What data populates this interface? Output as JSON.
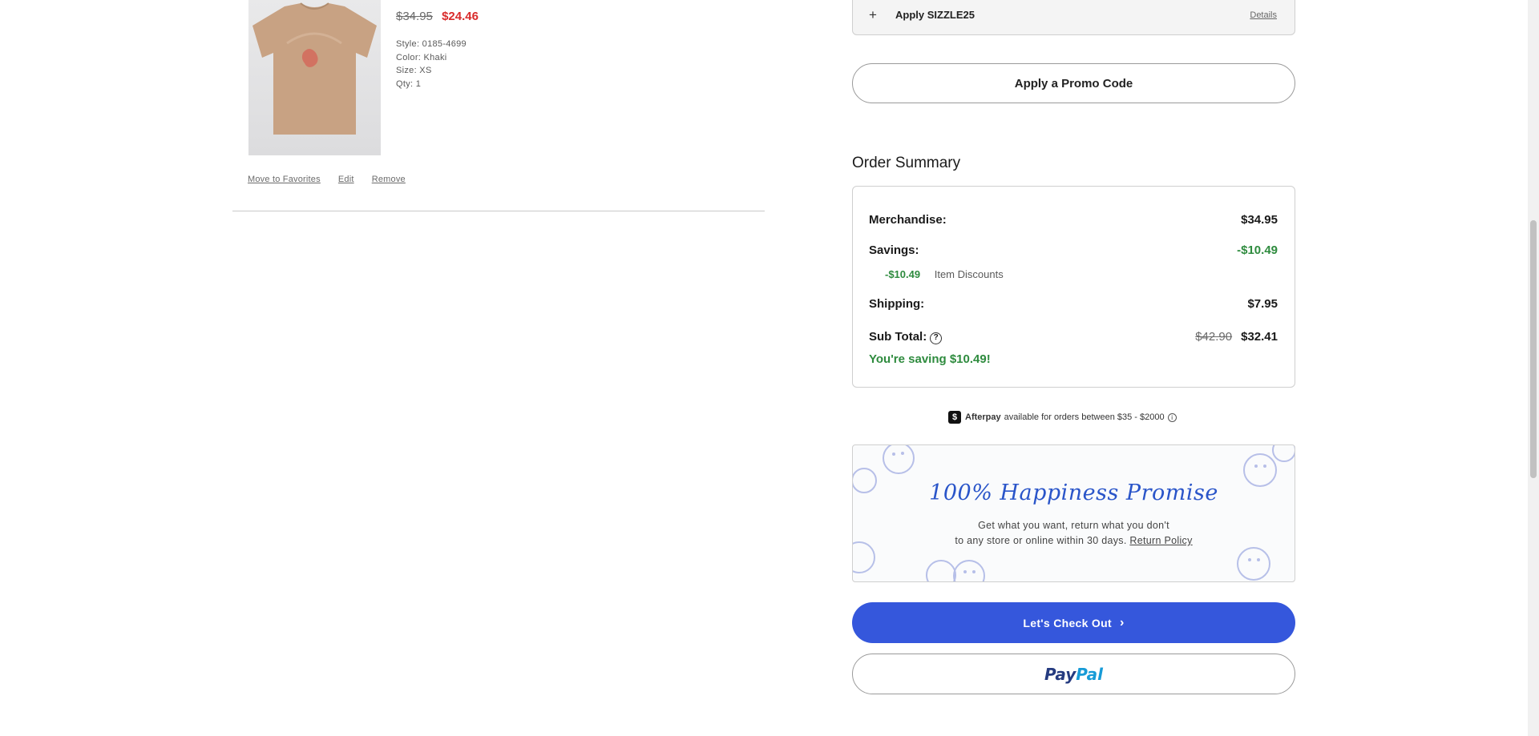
{
  "item": {
    "price_old": "$34.95",
    "price_new": "$24.46",
    "style": "Style: 0185-4699",
    "color": "Color: Khaki",
    "size": "Size: XS",
    "qty": "Qty: 1",
    "actions": [
      "Move to Favorites",
      "Edit",
      "Remove"
    ]
  },
  "coupon": {
    "label": "Apply SIZZLE25",
    "details": "Details"
  },
  "promo_button": "Apply a Promo Code",
  "summary": {
    "title": "Order Summary",
    "merchandise_label": "Merchandise:",
    "merchandise_value": "$34.95",
    "savings_label": "Savings:",
    "savings_value": "-$10.49",
    "discount_amount": "-$10.49",
    "discount_name": "Item Discounts",
    "shipping_label": "Shipping:",
    "shipping_value": "$7.95",
    "subtotal_label": "Sub Total:",
    "subtotal_old": "$42.90",
    "subtotal_value": "$32.41",
    "saving_message": "You're saving $10.49!"
  },
  "afterpay": {
    "brand": "Afterpay",
    "text": "available for orders between $35 - $2000"
  },
  "promise": {
    "title": "100% Happiness Promise",
    "line1": "Get what you want, return what you don't",
    "line2": "to any store or online within 30 days.",
    "link": "Return Policy"
  },
  "checkout_button": "Let's Check Out",
  "paypal": {
    "part1": "Pay",
    "part2": "Pal"
  },
  "colors": {
    "sale_red": "#d92b2b",
    "savings_green": "#2e8b3e",
    "checkout_blue": "#3557dc"
  }
}
